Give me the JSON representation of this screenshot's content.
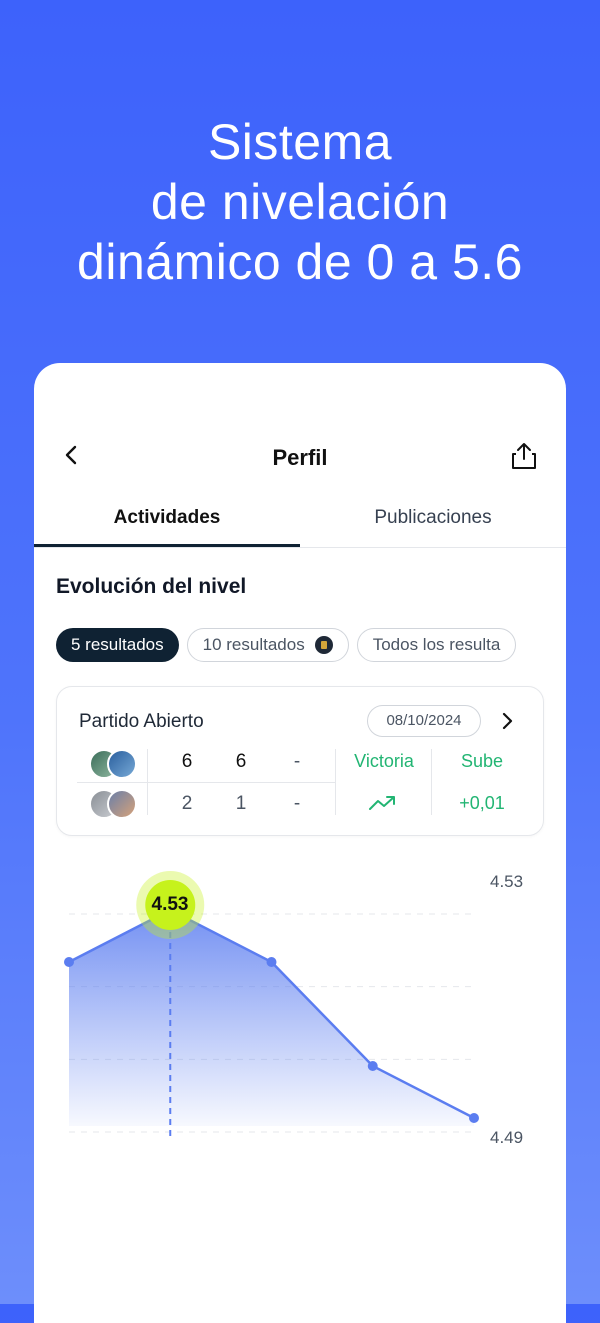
{
  "headline": {
    "line1": "Sistema",
    "line2": "de nivelación",
    "line3": "dinámico de 0 a 5.6"
  },
  "nav": {
    "title": "Perfil",
    "back_icon": "chevron-left-icon",
    "share_icon": "share-icon"
  },
  "tabs": [
    {
      "label": "Actividades",
      "active": true
    },
    {
      "label": "Publicaciones",
      "active": false
    }
  ],
  "section": {
    "title": "Evolución del nivel"
  },
  "chips": [
    {
      "label": "5 resultados",
      "active": true
    },
    {
      "label": "10 resultados",
      "active": false,
      "icon": "lock-icon"
    },
    {
      "label": "Todos los resulta",
      "active": false
    }
  ],
  "match": {
    "type": "Partido Abierto",
    "date": "08/10/2024",
    "rows": [
      {
        "set1": "6",
        "set2": "6",
        "set3": "-"
      },
      {
        "set1": "2",
        "set2": "1",
        "set3": "-"
      }
    ],
    "result": "Victoria",
    "level_change_label": "Sube",
    "level_change_value": "+0,01",
    "accent": "#22b573"
  },
  "chart_data": {
    "type": "area",
    "x": [
      1,
      2,
      3,
      4,
      5
    ],
    "values": [
      4.52,
      4.53,
      4.52,
      4.5,
      4.49
    ],
    "ylim": [
      4.49,
      4.53
    ],
    "y_ticks": [
      "4.53",
      "4.49"
    ],
    "highlight_label": "4.53",
    "highlight_index": 1,
    "grid": "dashed horizontal",
    "line_color": "#5b7df0",
    "highlight_color": "#c6f21c"
  }
}
